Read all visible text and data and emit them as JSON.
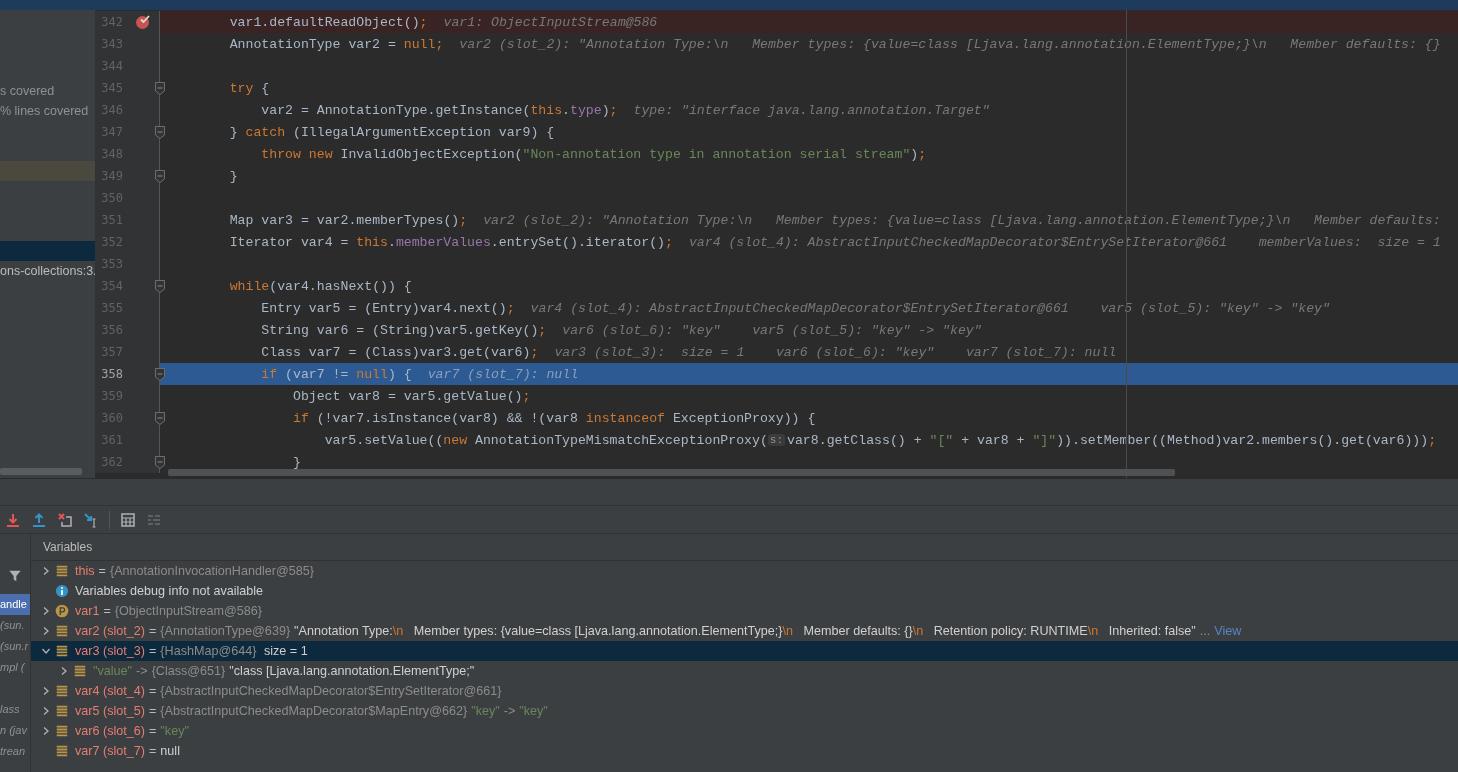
{
  "editor_tab_strip": {
    "kind": "tabs"
  },
  "coverage_panel": {
    "rows": [
      {
        "text": "s covered",
        "selected": false,
        "highlighted": false
      },
      {
        "text": "% lines covered",
        "selected": false,
        "highlighted": false
      },
      {
        "selected": false,
        "highlighted": true
      },
      {
        "selected": true,
        "highlighted": false
      },
      {
        "text": "ons-collections:3.",
        "selected": false,
        "highlighted": false
      }
    ]
  },
  "editor": {
    "lines": [
      {
        "number": "342",
        "breakpoint": true,
        "current": false,
        "fold": false,
        "segments": [
          {
            "kind": "code",
            "text": "    var1.defaultReadObject();"
          },
          {
            "kind": "hint",
            "text": "var1: ObjectInputStream@586"
          }
        ]
      },
      {
        "number": "343",
        "breakpoint": false,
        "current": false,
        "fold": false,
        "segments": [
          {
            "kind": "code",
            "text": "    AnnotationType var2 = null;"
          },
          {
            "kind": "hint",
            "text": "var2 (slot_2): \"Annotation Type:\\n   Member types: {value=class [Ljava.lang.annotation.ElementType;}\\n   Member defaults: {}"
          }
        ]
      },
      {
        "number": "344",
        "breakpoint": false,
        "current": false,
        "fold": false
      },
      {
        "number": "345",
        "breakpoint": false,
        "current": false,
        "fold": true,
        "segments": [
          {
            "kind": "code",
            "text": "    try {"
          }
        ]
      },
      {
        "number": "346",
        "breakpoint": false,
        "current": false,
        "fold": false,
        "segments": [
          {
            "kind": "code",
            "text": "        var2 = AnnotationType.getInstance(this.type);"
          },
          {
            "kind": "hint",
            "text": "type: \"interface java.lang.annotation.Target\""
          }
        ]
      },
      {
        "number": "347",
        "breakpoint": false,
        "current": false,
        "fold": true,
        "segments": [
          {
            "kind": "code",
            "text": "    } catch (IllegalArgumentException var9) {"
          }
        ]
      },
      {
        "number": "348",
        "breakpoint": false,
        "current": false,
        "fold": false,
        "segments": [
          {
            "kind": "code",
            "text": "        throw new InvalidObjectException(\"Non-annotation type in annotation serial stream\");"
          }
        ]
      },
      {
        "number": "349",
        "breakpoint": false,
        "current": false,
        "fold": true,
        "segments": [
          {
            "kind": "code",
            "text": "    }"
          }
        ]
      },
      {
        "number": "350",
        "breakpoint": false,
        "current": false,
        "fold": false
      },
      {
        "number": "351",
        "breakpoint": false,
        "current": false,
        "fold": false,
        "segments": [
          {
            "kind": "code",
            "text": "    Map var3 = var2.memberTypes();"
          },
          {
            "kind": "hint",
            "text": "var2 (slot_2): \"Annotation Type:\\n   Member types: {value=class [Ljava.lang.annotation.ElementType;}\\n   Member defaults:"
          }
        ]
      },
      {
        "number": "352",
        "breakpoint": false,
        "current": false,
        "fold": false,
        "segments": [
          {
            "kind": "code",
            "text": "    Iterator var4 = this.memberValues.entrySet().iterator();"
          },
          {
            "kind": "hint",
            "text": "var4 (slot_4): AbstractInputCheckedMapDecorator$EntrySetIterator@661    memberValues:  size = 1"
          }
        ]
      },
      {
        "number": "353",
        "breakpoint": false,
        "current": false,
        "fold": false
      },
      {
        "number": "354",
        "breakpoint": false,
        "current": false,
        "fold": true,
        "segments": [
          {
            "kind": "code",
            "text": "    while(var4.hasNext()) {"
          }
        ]
      },
      {
        "number": "355",
        "breakpoint": false,
        "current": false,
        "fold": false,
        "segments": [
          {
            "kind": "code",
            "text": "        Entry var5 = (Entry)var4.next();"
          },
          {
            "kind": "hint",
            "text": "var4 (slot_4): AbstractInputCheckedMapDecorator$EntrySetIterator@661    var5 (slot_5): \"key\" -> \"key\""
          }
        ]
      },
      {
        "number": "356",
        "breakpoint": false,
        "current": false,
        "fold": false,
        "segments": [
          {
            "kind": "code",
            "text": "        String var6 = (String)var5.getKey();"
          },
          {
            "kind": "hint",
            "text": "var6 (slot_6): \"key\"    var5 (slot_5): \"key\" -> \"key\""
          }
        ]
      },
      {
        "number": "357",
        "breakpoint": false,
        "current": false,
        "fold": false,
        "segments": [
          {
            "kind": "code",
            "text": "        Class var7 = (Class)var3.get(var6);"
          },
          {
            "kind": "hint",
            "text": "var3 (slot_3):  size = 1    var6 (slot_6): \"key\"    var7 (slot_7): null"
          }
        ]
      },
      {
        "number": "358",
        "breakpoint": false,
        "current": true,
        "fold": true,
        "segments": [
          {
            "kind": "code",
            "text": "        if (var7 != null) {"
          },
          {
            "kind": "hint",
            "text": "var7 (slot_7): null"
          }
        ]
      },
      {
        "number": "359",
        "breakpoint": false,
        "current": false,
        "fold": false,
        "segments": [
          {
            "kind": "code",
            "text": "            Object var8 = var5.getValue();"
          }
        ]
      },
      {
        "number": "360",
        "breakpoint": false,
        "current": false,
        "fold": true,
        "segments": [
          {
            "kind": "code",
            "text": "            if (!var7.isInstance(var8) && !(var8 instanceof ExceptionProxy)) {"
          }
        ]
      },
      {
        "number": "361",
        "breakpoint": false,
        "current": false,
        "fold": false,
        "segments": [
          {
            "kind": "code",
            "text": "                var5.setValue((new AnnotationTypeMismatchExceptionProxy("
          },
          {
            "kind": "param_hint",
            "text": "s:"
          },
          {
            "kind": "code",
            "text": "var8.getClass() + \"[\" + var8 + \"]\")).setMember((Method)var2.members().get(var6)));"
          }
        ]
      },
      {
        "number": "362",
        "breakpoint": false,
        "current": false,
        "fold": true,
        "segments": [
          {
            "kind": "code",
            "text": "            }"
          }
        ]
      }
    ]
  },
  "frames": [
    {
      "text": "andle",
      "selected": true
    },
    {
      "text": "(sun.",
      "selected": false
    },
    {
      "text": "(sun.r",
      "selected": false
    },
    {
      "text": "mpl (",
      "selected": false
    },
    {
      "text": "lass",
      "selected": false
    },
    {
      "text": "n (jav",
      "selected": false
    },
    {
      "text": "trean",
      "selected": false
    }
  ],
  "variables": {
    "title": "Variables",
    "rows": [
      {
        "expandable": true,
        "expanded": false,
        "kind": "field",
        "selected": false,
        "parts": [
          {
            "t": "this",
            "kind": "name"
          },
          {
            "t": "=",
            "kind": "op"
          },
          {
            "t": "{AnnotationInvocationHandler@585}",
            "kind": "ref"
          }
        ]
      },
      {
        "expandable": false,
        "kind": "info",
        "selected": false,
        "parts": [
          {
            "t": "Variables debug info not available",
            "kind": "text"
          }
        ]
      },
      {
        "expandable": true,
        "expanded": false,
        "kind": "parameter",
        "selected": false,
        "parts": [
          {
            "t": "var1",
            "kind": "name"
          },
          {
            "t": "=",
            "kind": "op"
          },
          {
            "t": "{ObjectInputStream@586}",
            "kind": "ref"
          }
        ]
      },
      {
        "expandable": true,
        "expanded": false,
        "kind": "field",
        "selected": false,
        "parts": [
          {
            "t": "var2 (slot_2)",
            "kind": "name"
          },
          {
            "t": "=",
            "kind": "op"
          },
          {
            "t": "{AnnotationType@639}",
            "kind": "ref"
          },
          {
            "t": "\"Annotation Type:\\n   Member types: {value=class [Ljava.lang.annotation.ElementType;}\\n   Member defaults: {}\\n   Retention policy: RUNTIME\\n   Inherited: false\"",
            "kind": "text"
          },
          {
            "t": "...",
            "kind": "ref"
          },
          {
            "t": "View",
            "kind": "link"
          }
        ]
      },
      {
        "expandable": true,
        "expanded": true,
        "kind": "field",
        "selected": true,
        "parts": [
          {
            "t": "var3 (slot_3)",
            "kind": "name"
          },
          {
            "t": "=",
            "kind": "op"
          },
          {
            "t": "{HashMap@644}",
            "kind": "ref"
          },
          {
            "t": " size = 1",
            "kind": "text"
          }
        ],
        "children": [
          {
            "expandable": true,
            "expanded": false,
            "kind": "field",
            "selected": false,
            "parts": [
              {
                "t": "\"value\"",
                "kind": "string"
              },
              {
                "t": "->",
                "kind": "ref"
              },
              {
                "t": "{Class@651}",
                "kind": "ref"
              },
              {
                "t": "\"class [Ljava.lang.annotation.ElementType;\"",
                "kind": "text"
              }
            ]
          }
        ]
      },
      {
        "expandable": true,
        "expanded": false,
        "kind": "field",
        "selected": false,
        "parts": [
          {
            "t": "var4 (slot_4)",
            "kind": "name"
          },
          {
            "t": "=",
            "kind": "op"
          },
          {
            "t": "{AbstractInputCheckedMapDecorator$EntrySetIterator@661}",
            "kind": "ref"
          }
        ]
      },
      {
        "expandable": true,
        "expanded": false,
        "kind": "field",
        "selected": false,
        "parts": [
          {
            "t": "var5 (slot_5)",
            "kind": "name"
          },
          {
            "t": "=",
            "kind": "op"
          },
          {
            "t": "{AbstractInputCheckedMapDecorator$MapEntry@662}",
            "kind": "ref"
          },
          {
            "t": "\"key\"",
            "kind": "string"
          },
          {
            "t": "->",
            "kind": "ref"
          },
          {
            "t": "\"key\"",
            "kind": "string"
          }
        ]
      },
      {
        "expandable": true,
        "expanded": false,
        "kind": "field",
        "selected": false,
        "parts": [
          {
            "t": "var6 (slot_6)",
            "kind": "name"
          },
          {
            "t": "=",
            "kind": "op"
          },
          {
            "t": "\"key\"",
            "kind": "string"
          }
        ]
      },
      {
        "expandable": false,
        "kind": "field",
        "selected": false,
        "parts": [
          {
            "t": "var7 (slot_7)",
            "kind": "name"
          },
          {
            "t": "=",
            "kind": "op"
          },
          {
            "t": "null",
            "kind": "text"
          }
        ]
      }
    ]
  }
}
